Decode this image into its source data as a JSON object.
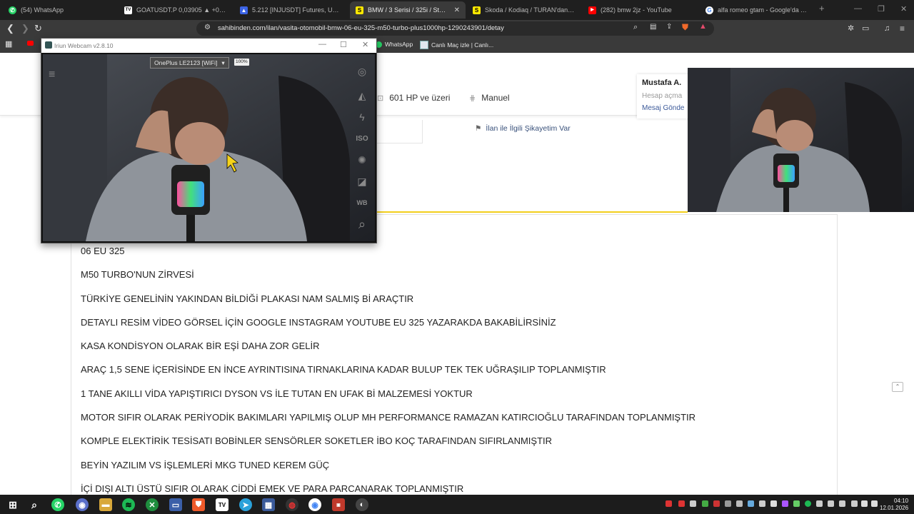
{
  "browser": {
    "tabs": [
      {
        "title": "(54) WhatsApp",
        "icon": "whatsapp-icon",
        "color": "#25d366",
        "glyph": "✆"
      },
      {
        "title": "GOATUSDT.P 0,03905 ▲ +0.62% Soy",
        "icon": "tradingview-icon",
        "color": "#ffffff",
        "glyph": "TV"
      },
      {
        "title": "5.212 [INJUSDT] Futures, USDT-Marg",
        "icon": "binance-icon",
        "color": "#3c64e6",
        "glyph": "▲"
      },
      {
        "title": "BMW / 3 Serisi / 325i / Standart",
        "icon": "sahibinden-icon",
        "color": "#ffe800",
        "glyph": "S",
        "active": true
      },
      {
        "title": "Skoda / Kodiaq / TURAN'dan SADEC",
        "icon": "sahibinden-icon",
        "color": "#ffe800",
        "glyph": "S"
      },
      {
        "title": "(282) bmw 2jz - YouTube",
        "icon": "youtube-icon",
        "color": "#ff0000",
        "glyph": "▶"
      },
      {
        "title": "alfa romeo gtam - Google'da Ara",
        "icon": "google-icon",
        "color": "#ffffff",
        "glyph": "G"
      }
    ],
    "url": "sahibinden.com/ilan/vasita-otomobil-bmw-06-eu-325-m50-turbo-plus1000hp-1290243901/detay",
    "bookmarks": [
      {
        "label": "WhatsApp",
        "icon": "whatsapp-icon"
      },
      {
        "label": "Canlı Maç izle | Canlı...",
        "icon": "bookmark-site-icon"
      }
    ]
  },
  "listing": {
    "specs": [
      {
        "label": "601 HP ve üzeri",
        "icon": "horsepower-icon"
      },
      {
        "label": "Manuel",
        "icon": "gearbox-icon"
      }
    ],
    "complaint_link": "İlan ile İlgili Şikayetim Var",
    "seller": {
      "name": "Mustafa A.",
      "sub": "Hesap açma",
      "message": "Mesaj Gönde"
    },
    "description": [
      "06 EU 325",
      "M50 TURBO'NUN ZİRVESİ",
      "TÜRKİYE GENELİNİN YAKINDAN BİLDİĞİ PLAKASI NAM SALMIŞ Bİ ARAÇTIR",
      "DETAYLI RESİM VİDEO GÖRSEL İÇİN GOOGLE INSTAGRAM YOUTUBE EU 325 YAZARAKDA BAKABİLİRSİNİZ",
      "KASA KONDİSYON OLARAK BİR EŞİ DAHA ZOR GELİR",
      "ARAÇ 1,5 SENE İÇERİSİNDE EN İNCE AYRINTISINA TIRNAKLARINA KADAR BULUP TEK TEK UĞRAŞILIP TOPLANMIŞTIR",
      "1 TANE AKILLI VİDA YAPIŞTIRICI DYSON VS İLE TUTAN EN UFAK Bİ MALZEMESİ YOKTUR",
      "MOTOR SIFIR OLARAK PERİYODİK BAKIMLARI YAPILMIŞ OLUP MH PERFORMANCE RAMAZAN KATIRCIOĞLU TARAFINDAN TOPLANMIŞTIR",
      "KOMPLE ELEKTİRİK TESİSATI BOBİNLER SENSÖRLER SOKETLER İBO KOÇ TARAFINDAN SIFIRLANMIŞTIR",
      "BEYİN YAZILIM VS İŞLEMLERİ MKG TUNED KEREM GÜÇ",
      "İÇİ DIŞI ALTI ÜSTÜ SIFIR OLARAK CİDDİ EMEK VE PARA PARCANARAK TOPLANMIŞTIR"
    ]
  },
  "webcam": {
    "title": "Iriun Webcam v2.8.10",
    "device": "OnePlus LE2123 [WiFi]",
    "zoom": "100%",
    "side_controls": [
      "menu-icon",
      "focus-icon",
      "exposure-icon",
      "flash-icon",
      "ISO",
      "aperture-icon",
      "white-balance-icon",
      "WB",
      "zoom-icon"
    ]
  },
  "taskbar": {
    "time": "04:10",
    "date": "12.01.2026"
  },
  "colors": {
    "accent_yellow": "#f2cf1d",
    "link_blue": "#38507a",
    "tab_bg": "#1f1f1f",
    "toolbar_bg": "#3a3a3a"
  }
}
